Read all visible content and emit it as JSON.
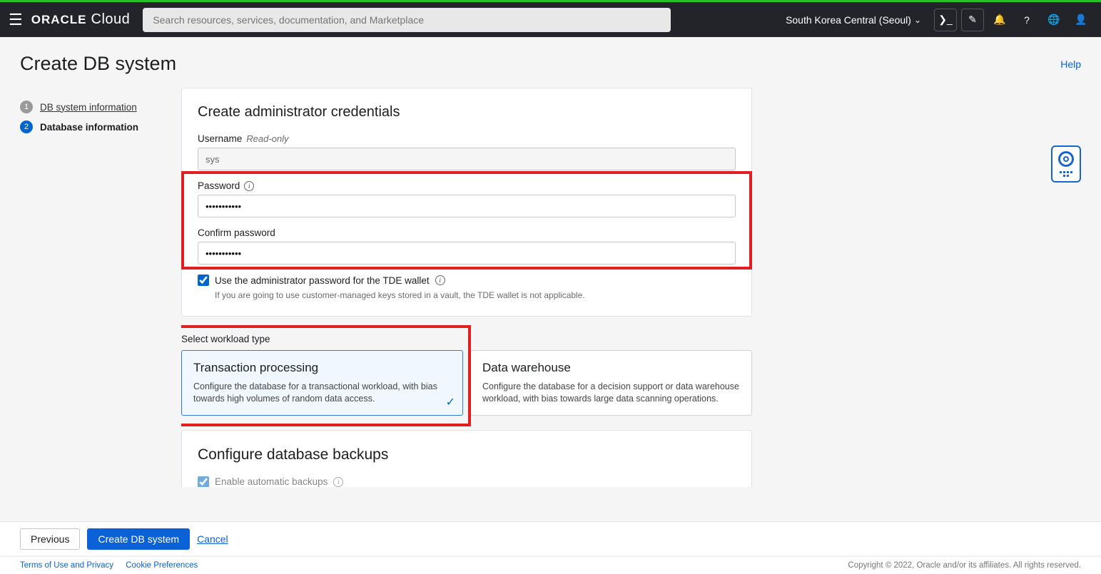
{
  "header": {
    "search_placeholder": "Search resources, services, documentation, and Marketplace",
    "region": "South Korea Central (Seoul)",
    "logo_brand": "ORACLE",
    "logo_product": "Cloud"
  },
  "page": {
    "title": "Create DB system",
    "help_link": "Help"
  },
  "sidebar": {
    "steps": [
      {
        "num": "1",
        "label": "DB system information"
      },
      {
        "num": "2",
        "label": "Database information"
      }
    ]
  },
  "credentials": {
    "heading": "Create administrator credentials",
    "username_label": "Username",
    "username_readonly_tag": "Read-only",
    "username_value": "sys",
    "password_label": "Password",
    "password_value": "•••••••••••",
    "confirm_label": "Confirm password",
    "confirm_value": "•••••••••••",
    "tde_checkbox_label": "Use the administrator password for the TDE wallet",
    "tde_checked": true,
    "tde_hint": "If you are going to use customer-managed keys stored in a vault, the TDE wallet is not applicable."
  },
  "workload": {
    "section_label": "Select workload type",
    "options": [
      {
        "title": "Transaction processing",
        "desc": "Configure the database for a transactional workload, with bias towards high volumes of random data access.",
        "selected": true
      },
      {
        "title": "Data warehouse",
        "desc": "Configure the database for a decision support or data warehouse workload, with bias towards large data scanning operations.",
        "selected": false
      }
    ]
  },
  "backups": {
    "heading": "Configure database backups",
    "enable_label": "Enable automatic backups",
    "enable_checked": true
  },
  "footer": {
    "previous": "Previous",
    "submit": "Create DB system",
    "cancel": "Cancel"
  },
  "legal": {
    "terms": "Terms of Use and Privacy",
    "cookies": "Cookie Preferences",
    "copyright": "Copyright © 2022, Oracle and/or its affiliates. All rights reserved."
  }
}
